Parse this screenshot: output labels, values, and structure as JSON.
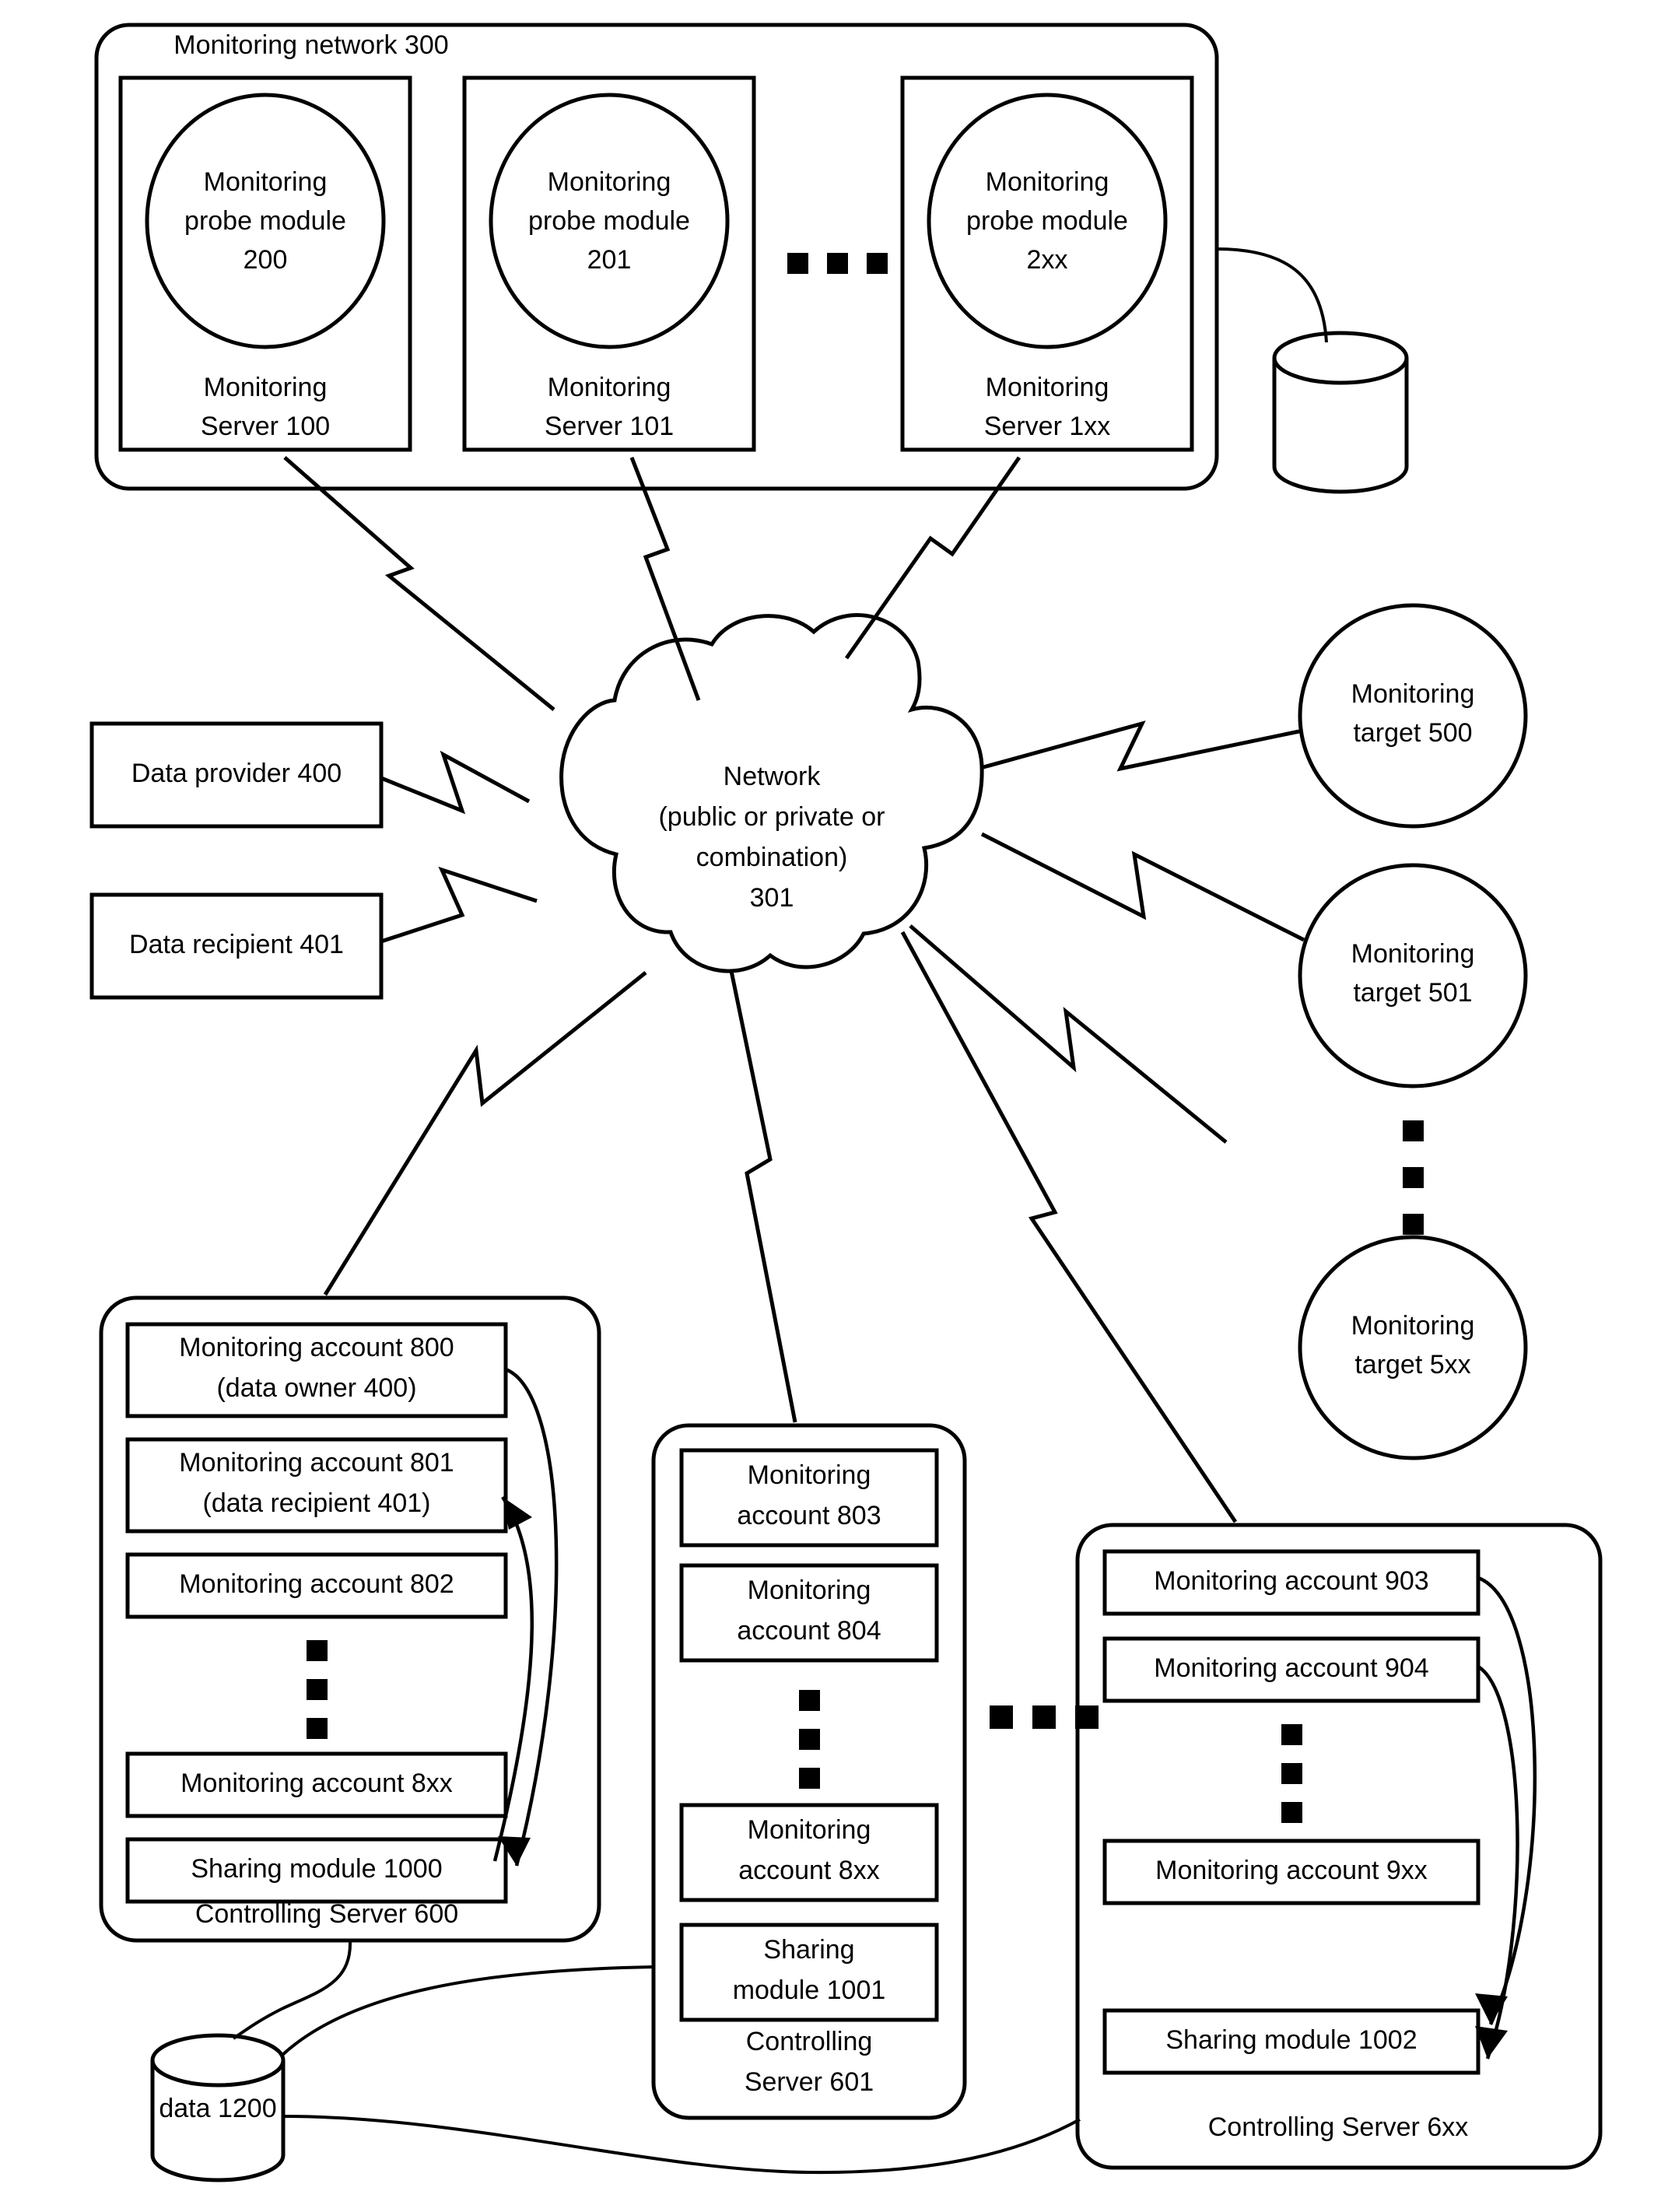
{
  "diagram": {
    "monitoring_network": {
      "title": "Monitoring network 300",
      "servers": [
        {
          "probe_label_line1": "Monitoring",
          "probe_label_line2": "probe module",
          "probe_label_line3": "200",
          "server_label_line1": "Monitoring",
          "server_label_line2": "Server 100"
        },
        {
          "probe_label_line1": "Monitoring",
          "probe_label_line2": "probe module",
          "probe_label_line3": "201",
          "server_label_line1": "Monitoring",
          "server_label_line2": "Server 101"
        },
        {
          "probe_label_line1": "Monitoring",
          "probe_label_line2": "probe module",
          "probe_label_line3": "2xx",
          "server_label_line1": "Monitoring",
          "server_label_line2": "Server 1xx"
        }
      ],
      "ellipsis": "■ ■ ■"
    },
    "network_cloud": {
      "line1": "Network",
      "line2": "(public or private or",
      "line3": "combination)",
      "line4": "301"
    },
    "left_boxes": [
      {
        "label": "Data provider 400"
      },
      {
        "label": "Data recipient 401"
      }
    ],
    "monitoring_targets": [
      {
        "line1": "Monitoring",
        "line2": "target 500"
      },
      {
        "line1": "Monitoring",
        "line2": "target 501"
      },
      {
        "line1": "Monitoring",
        "line2": "target 5xx"
      }
    ],
    "controlling_servers": [
      {
        "name": "Controlling Server 600",
        "name_line1": "Controlling Server 600",
        "name_line2": "",
        "accounts": [
          {
            "line1": "Monitoring account 800",
            "line2": "(data owner 400)"
          },
          {
            "line1": "Monitoring account 801",
            "line2": "(data recipient 401)"
          },
          {
            "line1": "Monitoring account 802",
            "line2": ""
          },
          {
            "line1": "Monitoring account 8xx",
            "line2": ""
          }
        ],
        "sharing_module": {
          "line1": "Sharing module 1000",
          "line2": ""
        }
      },
      {
        "name": "Controlling Server 601",
        "name_line1": "Controlling",
        "name_line2": "Server 601",
        "accounts": [
          {
            "line1": "Monitoring",
            "line2": "account 803"
          },
          {
            "line1": "Monitoring",
            "line2": "account 804"
          },
          {
            "line1": "Monitoring",
            "line2": "account 8xx"
          }
        ],
        "sharing_module": {
          "line1": "Sharing",
          "line2": "module 1001"
        }
      },
      {
        "name": "Controlling Server 6xx",
        "name_line1": "Controlling Server 6xx",
        "name_line2": "",
        "accounts": [
          {
            "line1": "Monitoring account 903",
            "line2": ""
          },
          {
            "line1": "Monitoring account 904",
            "line2": ""
          },
          {
            "line1": "Monitoring account 9xx",
            "line2": ""
          }
        ],
        "sharing_module": {
          "line1": "Sharing module 1002",
          "line2": ""
        }
      }
    ],
    "data_store": {
      "label": "data 1200"
    },
    "top_right_store": {
      "label": ""
    }
  }
}
